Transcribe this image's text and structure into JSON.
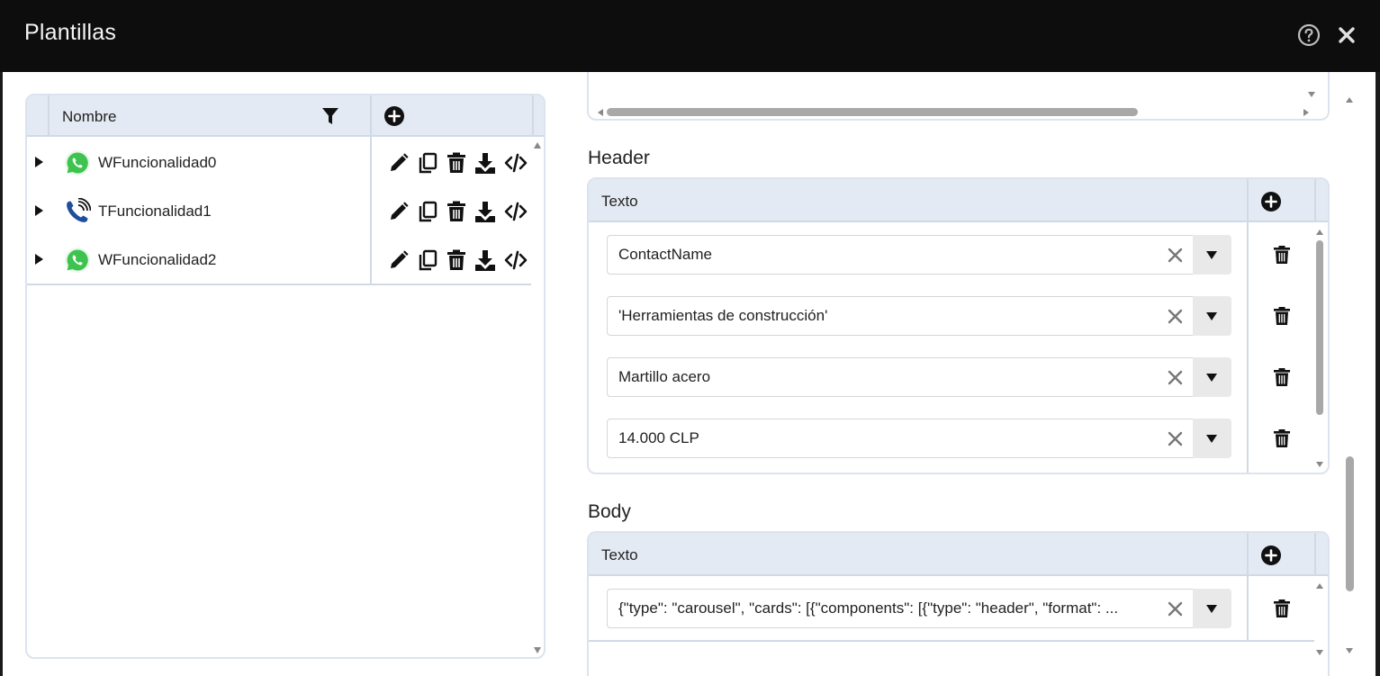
{
  "window": {
    "title": "Plantillas",
    "help_icon": "help-circle-icon",
    "close_icon": "close-icon"
  },
  "tree": {
    "header": {
      "name_label": "Nombre",
      "filter_icon": "filter-icon",
      "add_icon": "add-circle-icon"
    },
    "rows": [
      {
        "label": "WFuncionalidad0",
        "channel_icon": "whatsapp-icon"
      },
      {
        "label": "TFuncionalidad1",
        "channel_icon": "phone-call-icon"
      },
      {
        "label": "WFuncionalidad2",
        "channel_icon": "whatsapp-icon"
      }
    ],
    "row_actions": [
      "edit-icon",
      "copy-icon",
      "trash-icon",
      "download-icon",
      "code-icon"
    ]
  },
  "header_section": {
    "title": "Header",
    "column_label": "Texto",
    "items": [
      {
        "value": "ContactName"
      },
      {
        "value": "'Herramientas de construcción'"
      },
      {
        "value": "Martillo acero"
      },
      {
        "value": "14.000 CLP"
      }
    ]
  },
  "body_section": {
    "title": "Body",
    "column_label": "Texto",
    "items": [
      {
        "value": "{\"type\": \"carousel\", \"cards\": [{\"components\": [{\"type\": \"header\", \"format\": ..."
      }
    ]
  },
  "colors": {
    "titlebar": "#0d0d0d",
    "grid_header": "#e4eaf4",
    "whatsapp": "#3ec34f",
    "phone": "#1f4e9c"
  }
}
